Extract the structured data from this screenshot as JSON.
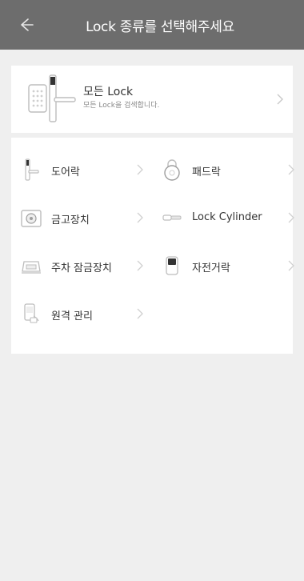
{
  "header": {
    "title": "Lock 종류를 선택해주세요"
  },
  "all_lock": {
    "title": "모든 Lock",
    "subtitle": "모든 Lock을 검색합니다."
  },
  "categories": [
    {
      "label": "도어락",
      "icon": "door-lock-icon"
    },
    {
      "label": "패드락",
      "icon": "padlock-icon"
    },
    {
      "label": "금고장치",
      "icon": "safe-icon"
    },
    {
      "label": "Lock Cylinder",
      "icon": "lock-cylinder-icon"
    },
    {
      "label": "주차 잠금장치",
      "icon": "parking-lock-icon"
    },
    {
      "label": "자전거락",
      "icon": "bike-lock-icon"
    },
    {
      "label": "원격 관리",
      "icon": "remote-management-icon"
    }
  ],
  "colors": {
    "header_bg": "#6d6d6d",
    "page_bg": "#efefef",
    "card_bg": "#ffffff"
  }
}
